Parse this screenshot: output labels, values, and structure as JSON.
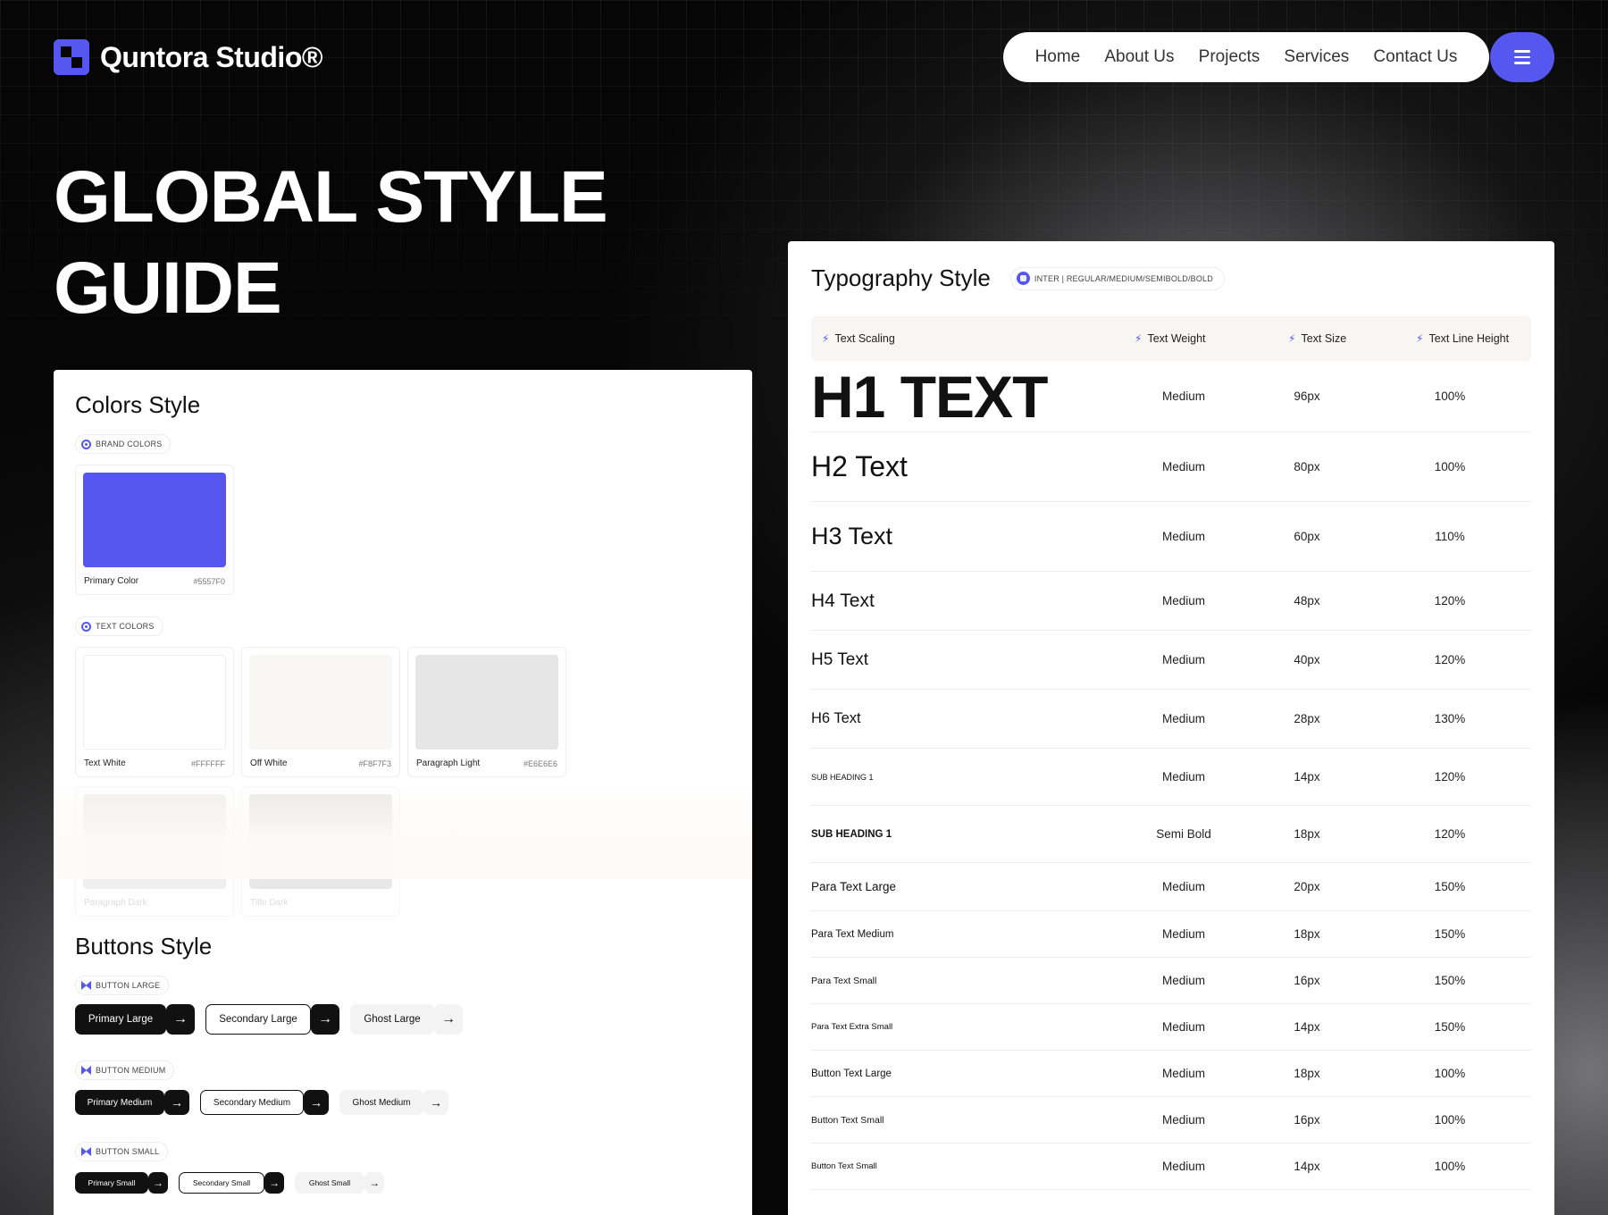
{
  "brand": {
    "name": "Quntora Studio®",
    "accent": "#5557F0"
  },
  "nav": {
    "items": [
      "Home",
      "About Us",
      "Projects",
      "Services",
      "Contact Us"
    ],
    "menu_icon": "hamburger-icon"
  },
  "hero": {
    "line1": "GLOBAL STYLE",
    "line2": "GUIDE"
  },
  "colors_card": {
    "title": "Colors Style",
    "brand_pill": "BRAND COLORS",
    "text_pill": "TEXT COLORS",
    "brand_colors": [
      {
        "name": "Primary Color",
        "hex": "#5557F0"
      }
    ],
    "text_colors": [
      {
        "name": "Text White",
        "hex": "#FFFFFF"
      },
      {
        "name": "Off White",
        "hex": "#F8F7F3"
      },
      {
        "name": "Paragraph Light",
        "hex": "#E6E6E6"
      }
    ],
    "faded_colors": [
      {
        "name": "Paragraph Dark",
        "swatch": "#EFEFEF"
      },
      {
        "name": "Title Dark",
        "swatch": "#E8E8E8"
      }
    ]
  },
  "buttons_card": {
    "title": "Buttons Style",
    "groups": [
      {
        "pill": "BUTTON LARGE",
        "primary": "Primary Large",
        "secondary": "Secondary Large",
        "ghost": "Ghost Large"
      },
      {
        "pill": "BUTTON MEDIUM",
        "primary": "Primary Medium",
        "secondary": "Secondary Medium",
        "ghost": "Ghost Medium"
      },
      {
        "pill": "BUTTON SMALL",
        "primary": "Primary Small",
        "secondary": "Secondary Small",
        "ghost": "Ghost Small"
      }
    ],
    "arrow": "→"
  },
  "typography": {
    "title": "Typography Style",
    "font_pill": "INTER | REGULAR/MEDIUM/SEMIBOLD/BOLD",
    "headers": [
      "Text Scaling",
      "Text Weight",
      "Text Size",
      "Text Line Height"
    ],
    "rows": [
      {
        "name": "H1 TEXT",
        "weight": "Medium",
        "size": "96px",
        "line": "100%"
      },
      {
        "name": "H2 Text",
        "weight": "Medium",
        "size": "80px",
        "line": "100%"
      },
      {
        "name": "H3 Text",
        "weight": "Medium",
        "size": "60px",
        "line": "110%"
      },
      {
        "name": "H4 Text",
        "weight": "Medium",
        "size": "48px",
        "line": "120%"
      },
      {
        "name": "H5 Text",
        "weight": "Medium",
        "size": "40px",
        "line": "120%"
      },
      {
        "name": "H6 Text",
        "weight": "Medium",
        "size": "28px",
        "line": "130%"
      },
      {
        "name": "SUB HEADING 1",
        "weight": "Medium",
        "size": "14px",
        "line": "120%"
      },
      {
        "name": "SUB HEADING 1",
        "weight": "Semi Bold",
        "size": "18px",
        "line": "120%"
      },
      {
        "name": "Para Text Large",
        "weight": "Medium",
        "size": "20px",
        "line": "150%"
      },
      {
        "name": "Para Text Medium",
        "weight": "Medium",
        "size": "18px",
        "line": "150%"
      },
      {
        "name": "Para Text Small",
        "weight": "Medium",
        "size": "16px",
        "line": "150%"
      },
      {
        "name": "Para Text Extra Small",
        "weight": "Medium",
        "size": "14px",
        "line": "150%"
      },
      {
        "name": "Button Text Large",
        "weight": "Medium",
        "size": "18px",
        "line": "100%"
      },
      {
        "name": "Button Text Small",
        "weight": "Medium",
        "size": "16px",
        "line": "100%"
      },
      {
        "name": "Button Text Small",
        "weight": "Medium",
        "size": "14px",
        "line": "100%"
      }
    ]
  }
}
